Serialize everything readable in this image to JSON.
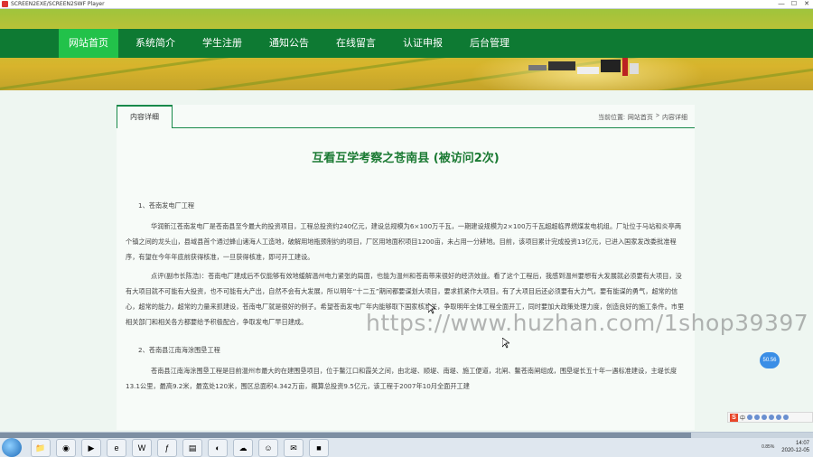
{
  "window": {
    "title": "SCREEN2EXE/SCREEN2SWF Player",
    "controls": [
      "—",
      "☐",
      "✕"
    ]
  },
  "nav": {
    "items": [
      {
        "label": "网站首页",
        "active": true
      },
      {
        "label": "系统简介",
        "active": false
      },
      {
        "label": "学生注册",
        "active": false
      },
      {
        "label": "通知公告",
        "active": false
      },
      {
        "label": "在线留言",
        "active": false
      },
      {
        "label": "认证申报",
        "active": false
      },
      {
        "label": "后台管理",
        "active": false
      }
    ]
  },
  "content": {
    "tab_label": "内容详细",
    "breadcrumb": {
      "prefix": "当前位置:",
      "home": "网站首页",
      "separator": ">",
      "current": "内容详细"
    },
    "article_title": "互看互学考察之苍南县 (被访问2次)",
    "paragraphs": [
      {
        "kind": "section",
        "text": "1、苍南发电厂工程"
      },
      {
        "kind": "indent",
        "text": "华润新江苍南发电厂是苍南县至今最大的投资项目，工程总投资约240亿元，建设总规模为6×100万千瓦，一期建设规模为2×100万千瓦超超临界燃煤发电机组。厂址位于马站和炎亭两个镇之间的龙头山，县域县首个通过蜂山诸海人工造地，破解用地瓶颈制约的项目，厂区用地面积项目1200亩，未占用一分耕地。目前，该项目累计完成投资13亿元，已进入国家发改委批准程序，有望在今年年底前获得核准，一旦获得核准，即可开工建设。"
      },
      {
        "kind": "indent",
        "text": "点评(副市长陈浩)：苍南电厂建成后不仅能够有效地缓解温州电力紧张的局面，也能为温州和苍南带来很好的经济效益。看了这个工程后，我感到温州要想有大发展就必须要有大项目，没有大项目就不可能有大投资，也不可能有大产出，自然不会有大发展，所以明年“十二五”期间都要谋划大项目，要求抓紧作大项目。有了大项目后还必须要有大力气，要有能谋的勇气，超常的信心，超常的能力，超常的力量来抓建设，苍南电厂就是很好的例子。希望苍南发电厂年内能够取下国家核准关，争取明年全体工程全面开工，同时要加大政策处理力度，创造良好的施工条件。市里相关部门和相关各方都要给予积极配合，争取发电厂早日建成。"
      },
      {
        "kind": "section",
        "text": "2、苍南县江南海涂围垦工程"
      },
      {
        "kind": "indent",
        "text": "苍南县江南海涂围垦工程是目前温州市最大的在建围垦项目，位于鳌江口和霞关之间，由北堤、顺堤、南堤、施工便道，北闸、鳌苍南闸组成，围垦堤长五十年一遇标准建设，主堤长度13.1公里，最高9.2米，最宽处120米，围区总面积4.342万亩，概算总投资9.5亿元，该工程于2007年10月全面开工建"
      }
    ]
  },
  "watermark": "https://www.huzhan.com/1shop39397",
  "float_badge": "50.56",
  "ime": {
    "logo": "S",
    "label": "中"
  },
  "taskbar": {
    "progress": 0.85,
    "zoom": "0.85%",
    "time": "14:07",
    "date": "2020-12-05",
    "apps": [
      "folder-icon",
      "chrome-icon",
      "media-icon",
      "ie-icon",
      "word-icon",
      "flash-icon",
      "folder2-icon",
      "qq-icon",
      "cloud-icon",
      "avatar-icon",
      "wechat-icon",
      "green-app-icon"
    ]
  },
  "colors": {
    "nav_bg": "#0e7a33",
    "nav_active": "#22c24a",
    "title_green": "#1b7a33",
    "border_green": "#18894a"
  }
}
